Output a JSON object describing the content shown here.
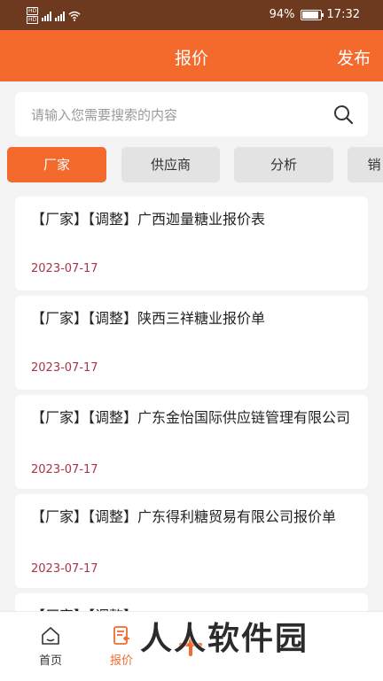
{
  "status_bar": {
    "battery": "94%",
    "time": "17:32",
    "battery_level": 0.94
  },
  "header": {
    "title": "报价",
    "publish_label": "发布"
  },
  "search": {
    "placeholder": "请输入您需要搜索的内容"
  },
  "tabs": [
    {
      "label": "厂家",
      "active": true
    },
    {
      "label": "供应商",
      "active": false
    },
    {
      "label": "分析",
      "active": false
    },
    {
      "label": "销",
      "active": false
    }
  ],
  "list": [
    {
      "title": "【厂家】【调整】广西迦量糖业报价表",
      "date": "2023-07-17"
    },
    {
      "title": "【厂家】【调整】陕西三祥糖业报价单",
      "date": "2023-07-17"
    },
    {
      "title": "【厂家】【调整】广东金怡国际供应链管理有限公司",
      "date": "2023-07-17"
    },
    {
      "title": "【厂家】【调整】广东得利糖贸易有限公司报价单",
      "date": "2023-07-17"
    },
    {
      "title": "【厂家】【调整】",
      "date": ""
    }
  ],
  "bottom_nav": {
    "home_label": "首页",
    "quote_label": "报价"
  },
  "watermark": "人人软件园",
  "colors": {
    "accent": "#f36a2c",
    "date": "#a8344a",
    "status_bar": "#6e3a1f"
  }
}
